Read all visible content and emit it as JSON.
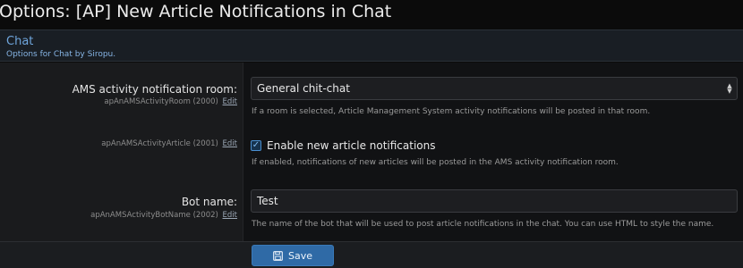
{
  "page": {
    "title": "Options: [AP] New Article Notifications in Chat"
  },
  "block": {
    "title": "Chat",
    "description": "Options for Chat by Siropu."
  },
  "options": [
    {
      "label": "AMS activity notification room:",
      "sub": "apAnAMSActivityRoom (2000)",
      "edit": "Edit",
      "value": "General chit-chat",
      "explain": "If a room is selected, Article Management System activity notifications will be posted in that room."
    },
    {
      "label": "",
      "sub": "apAnAMSActivityArticle (2001)",
      "edit": "Edit",
      "checkbox_label": "Enable new article notifications",
      "checked": true,
      "explain": "If enabled, notifications of new articles will be posted in the AMS activity notification room."
    },
    {
      "label": "Bot name:",
      "sub": "apAnAMSActivityBotName (2002)",
      "edit": "Edit",
      "value": "Test",
      "explain": "The name of the bot that will be used to post article notifications in the chat. You can use HTML to style the name."
    }
  ],
  "footer": {
    "save_label": "Save"
  },
  "icons": {
    "select": "select-arrows-icon",
    "checkbox": "check-icon",
    "save": "floppy-disk-icon"
  },
  "colors": {
    "accent": "#2f6aa6",
    "header_text": "#6fa6dd",
    "background": "#0b0b0b"
  }
}
